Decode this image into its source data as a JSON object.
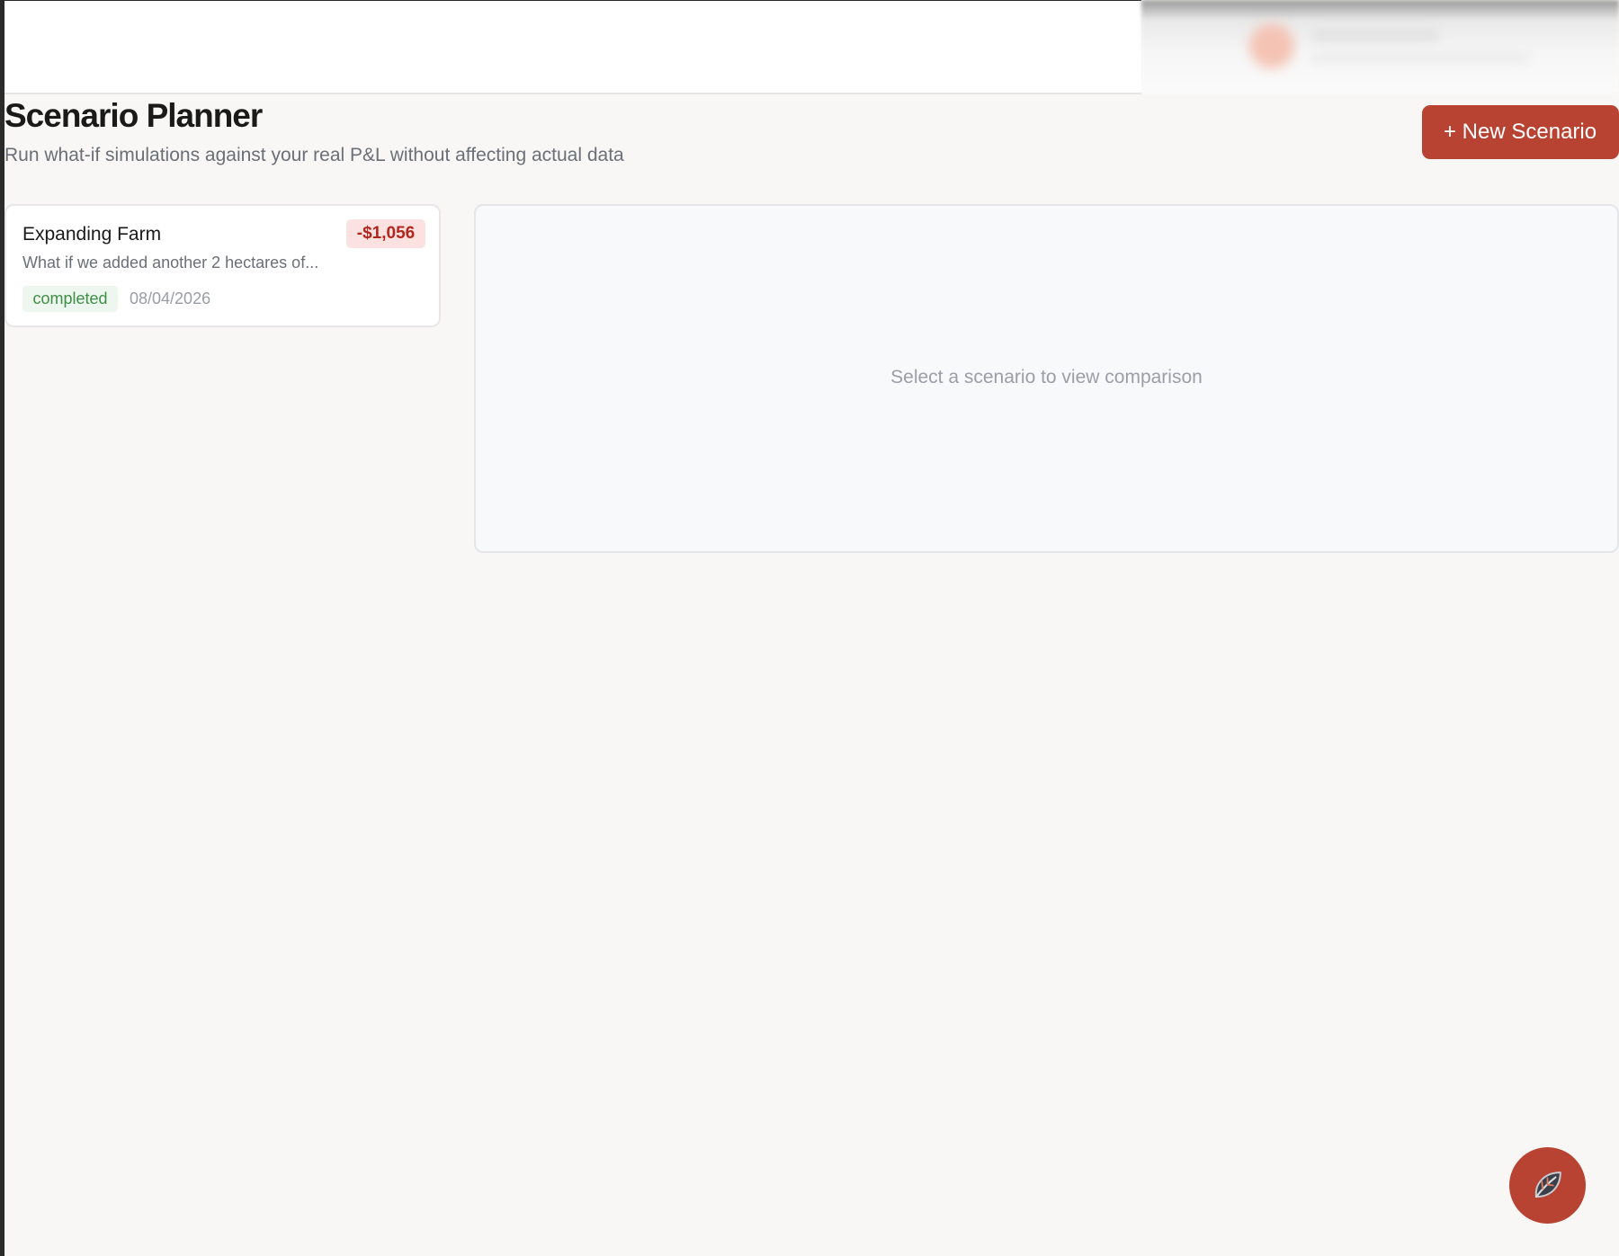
{
  "header": {
    "title": "Scenario Planner",
    "subtitle": "Run what-if simulations against your real P&L without affecting actual data",
    "new_button_label": "+ New Scenario"
  },
  "scenarios": [
    {
      "title": "Expanding Farm",
      "amount": "-$1,056",
      "description": "What if we added another 2 hectares of...",
      "status": "completed",
      "date": "08/04/2026"
    }
  ],
  "comparison": {
    "empty_text": "Select a scenario to view comparison"
  },
  "fab": {
    "icon": "leaf-icon"
  },
  "colors": {
    "accent": "#b94332",
    "negative": "#b3261e",
    "status_completed": "#3e8e45",
    "background": "#f8f7f5"
  }
}
